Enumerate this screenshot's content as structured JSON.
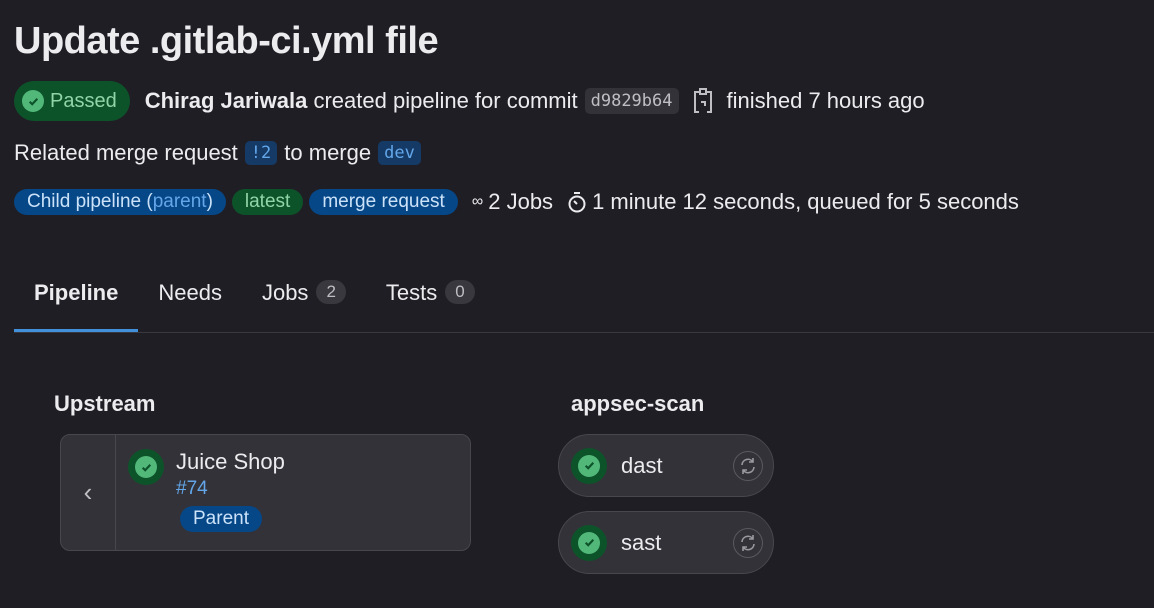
{
  "title": "Update .gitlab-ci.yml file",
  "status": "Passed",
  "author": "Chirag Jariwala",
  "created_text": "created pipeline for commit",
  "commit_sha": "d9829b64",
  "finished_text": "finished 7 hours ago",
  "mr": {
    "prefix": "Related merge request",
    "id": "!2",
    "middle": "to merge",
    "branch": "dev"
  },
  "badges": {
    "child_prefix": "Child pipeline (",
    "child_link": "parent",
    "child_suffix": ")",
    "latest": "latest",
    "merge_request": "merge request"
  },
  "jobs_count": "2 Jobs",
  "duration": "1 minute 12 seconds, queued for 5 seconds",
  "tabs": [
    {
      "label": "Pipeline"
    },
    {
      "label": "Needs"
    },
    {
      "label": "Jobs",
      "count": "2"
    },
    {
      "label": "Tests",
      "count": "0"
    }
  ],
  "upstream": {
    "heading": "Upstream",
    "project": "Juice Shop",
    "pipeline_id": "#74",
    "badge": "Parent"
  },
  "stage": {
    "heading": "appsec-scan",
    "jobs": [
      {
        "name": "dast"
      },
      {
        "name": "sast"
      }
    ]
  },
  "colors": {
    "success": "#52b87a",
    "link": "#63a6e9",
    "tab_active": "#428fdc"
  }
}
